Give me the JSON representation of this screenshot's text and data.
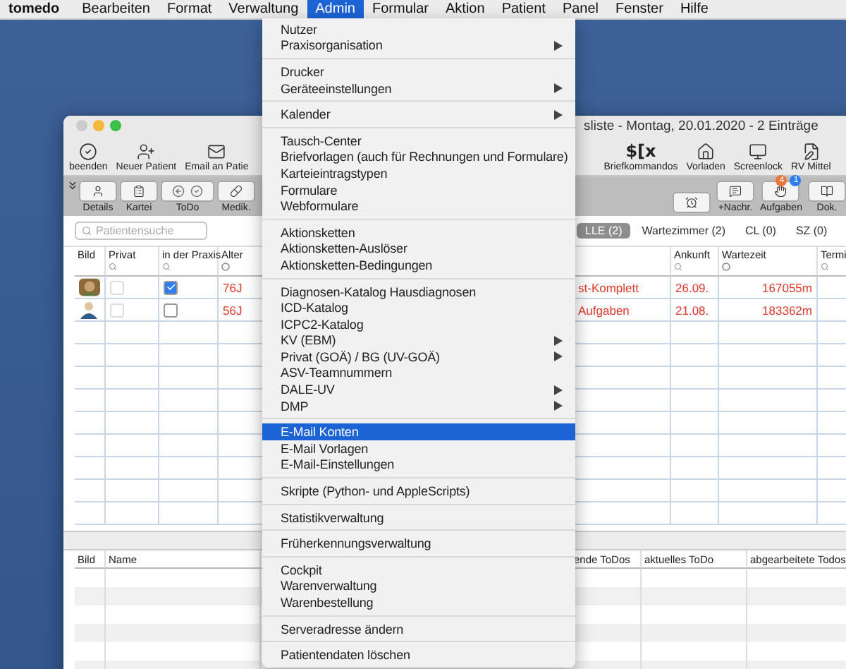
{
  "menubar": {
    "app": "tomedo",
    "items": [
      {
        "label": "Bearbeiten",
        "selected": false
      },
      {
        "label": "Format",
        "selected": false
      },
      {
        "label": "Verwaltung",
        "selected": false
      },
      {
        "label": "Admin",
        "selected": true
      },
      {
        "label": "Formular",
        "selected": false
      },
      {
        "label": "Aktion",
        "selected": false
      },
      {
        "label": "Patient",
        "selected": false
      },
      {
        "label": "Panel",
        "selected": false
      },
      {
        "label": "Fenster",
        "selected": false
      },
      {
        "label": "Hilfe",
        "selected": false
      }
    ]
  },
  "menu": {
    "groups": [
      [
        {
          "label": "Nutzer",
          "submenu": false,
          "selected": false
        },
        {
          "label": "Praxisorganisation",
          "submenu": true,
          "selected": false
        }
      ],
      [
        {
          "label": "Drucker",
          "submenu": false,
          "selected": false
        },
        {
          "label": "Geräteeinstellungen",
          "submenu": true,
          "selected": false
        }
      ],
      [
        {
          "label": "Kalender",
          "submenu": true,
          "selected": false
        }
      ],
      [
        {
          "label": "Tausch-Center",
          "submenu": false,
          "selected": false
        },
        {
          "label": "Briefvorlagen (auch für Rechnungen und Formulare)",
          "submenu": false,
          "selected": false
        },
        {
          "label": "Karteieintragstypen",
          "submenu": false,
          "selected": false
        },
        {
          "label": "Formulare",
          "submenu": false,
          "selected": false
        },
        {
          "label": "Webformulare",
          "submenu": false,
          "selected": false
        }
      ],
      [
        {
          "label": "Aktionsketten",
          "submenu": false,
          "selected": false
        },
        {
          "label": "Aktionsketten-Auslöser",
          "submenu": false,
          "selected": false
        },
        {
          "label": "Aktionsketten-Bedingungen",
          "submenu": false,
          "selected": false
        }
      ],
      [
        {
          "label": "Diagnosen-Katalog Hausdiagnosen",
          "submenu": false,
          "selected": false
        },
        {
          "label": "ICD-Katalog",
          "submenu": false,
          "selected": false
        },
        {
          "label": "ICPC2-Katalog",
          "submenu": false,
          "selected": false
        },
        {
          "label": "KV (EBM)",
          "submenu": true,
          "selected": false
        },
        {
          "label": "Privat (GOÄ) / BG (UV-GOÄ)",
          "submenu": true,
          "selected": false
        },
        {
          "label": "ASV-Teamnummern",
          "submenu": false,
          "selected": false
        },
        {
          "label": "DALE-UV",
          "submenu": true,
          "selected": false
        },
        {
          "label": "DMP",
          "submenu": true,
          "selected": false
        }
      ],
      [
        {
          "label": "E-Mail Konten",
          "submenu": false,
          "selected": true
        },
        {
          "label": "E-Mail Vorlagen",
          "submenu": false,
          "selected": false
        },
        {
          "label": "E-Mail-Einstellungen",
          "submenu": false,
          "selected": false
        }
      ],
      [
        {
          "label": "Skripte (Python- und AppleScripts)",
          "submenu": false,
          "selected": false
        }
      ],
      [
        {
          "label": "Statistikverwaltung",
          "submenu": false,
          "selected": false
        }
      ],
      [
        {
          "label": "Früherkennungsverwaltung",
          "submenu": false,
          "selected": false
        }
      ],
      [
        {
          "label": "Cockpit",
          "submenu": false,
          "selected": false
        },
        {
          "label": "Warenverwaltung",
          "submenu": false,
          "selected": false
        },
        {
          "label": "Warenbestellung",
          "submenu": false,
          "selected": false
        }
      ],
      [
        {
          "label": "Serveradresse ändern",
          "submenu": false,
          "selected": false
        }
      ],
      [
        {
          "label": "Patientendaten löschen",
          "submenu": false,
          "selected": false
        }
      ]
    ]
  },
  "window": {
    "title": "sliste - Montag, 20.01.2020 - 2 Einträge",
    "toolbar_left": [
      {
        "label": "beenden",
        "kind": "check"
      },
      {
        "label": "Neuer Patient",
        "kind": "user-plus"
      },
      {
        "label": "Email an Patie",
        "kind": "mail"
      }
    ],
    "toolbar_right": [
      {
        "label": "Briefkommandos",
        "kind": "glyph",
        "glyph": "$[x"
      },
      {
        "label": "Vorladen",
        "kind": "home"
      },
      {
        "label": "Screenlock",
        "kind": "monitor"
      },
      {
        "label": "RV Mittel",
        "kind": "file"
      }
    ],
    "nav_left": [
      {
        "label": "Details",
        "kind": "person"
      },
      {
        "label": "Kartei",
        "kind": "card"
      },
      {
        "label": "ToDo",
        "kind": "todo"
      },
      {
        "label": "Medik.",
        "kind": "pill"
      }
    ],
    "nav_right": [
      {
        "kind": "alarm"
      },
      {
        "label": "+Nachr.",
        "kind": "message"
      },
      {
        "label": "Aufgaben",
        "kind": "tasks",
        "badges": [
          {
            "text": "4",
            "color": "#e8763a"
          },
          {
            "text": "1",
            "color": "#2f7ef0"
          }
        ]
      },
      {
        "label": "Dok.",
        "kind": "book"
      }
    ],
    "search": {
      "placeholder": "Patientensuche"
    },
    "tabs": [
      {
        "label": "LLE (2)",
        "selected": true
      },
      {
        "label": "Wartezimmer (2)",
        "selected": false
      },
      {
        "label": "CL (0)",
        "selected": false
      },
      {
        "label": "SZ (0)",
        "selected": false
      }
    ],
    "table": {
      "columns": [
        "Bild",
        "Privat",
        "in der Praxis",
        "Alter",
        "Ankunft",
        "Wartezeit",
        "Termi"
      ],
      "rows": [
        {
          "privat": false,
          "in_praxis": true,
          "alter": "76J",
          "column_5": "st-Komplett",
          "ankunft": "26.09.",
          "wartezeit": "167055m"
        },
        {
          "privat": false,
          "in_praxis": false,
          "alter": "56J",
          "column_5": "Aufgaben",
          "ankunft": "21.08.",
          "wartezeit": "183362m"
        }
      ]
    },
    "bottom_table": {
      "columns": [
        "Bild",
        "Name",
        "ende ToDos",
        "aktuelles ToDo",
        "abgearbeitete Todos"
      ]
    }
  }
}
